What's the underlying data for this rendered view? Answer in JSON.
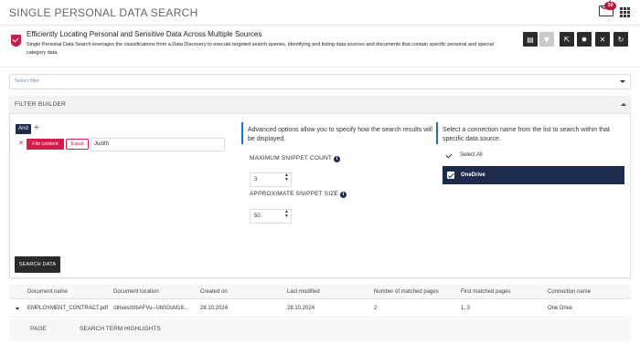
{
  "header": {
    "title": "SINGLE PERSONAL DATA SEARCH",
    "notification_count": "10"
  },
  "info": {
    "title": "Efficiently Locating Personal and Sensitive Data Across Multiple Sources",
    "description": "Single Personal Data Search leverages the classifications from a Data Discovery to execute targeted search queries, identifying and listing data sources and documents that contain specific personal and special category data."
  },
  "toolbar": {
    "buttons": [
      {
        "icon": "save-icon",
        "glyph": "▤"
      },
      {
        "icon": "filter-icon",
        "glyph": "▼",
        "disabled": true
      },
      {
        "icon": "export-icon",
        "glyph": "⇱"
      },
      {
        "icon": "settings-icon",
        "glyph": "✹"
      },
      {
        "icon": "close-icon",
        "glyph": "✕"
      },
      {
        "icon": "refresh-icon",
        "glyph": "↻"
      }
    ]
  },
  "filter_select": {
    "placeholder": "Select filter"
  },
  "filter_builder": {
    "title": "FILTER BUILDER",
    "and_label": "And",
    "plus_label": "+",
    "remove_label": "✕",
    "field_chip": "File content",
    "operator_chip": "Equal",
    "value": "Judith",
    "advanced_text": "Advanced options allow you to specify how the search results will be displayed.",
    "max_snippet_label": "MAXIMUM SNIPPET COUNT",
    "max_snippet_value": "3",
    "approx_snippet_label": "APPROXIMATE SNIPPET SIZE",
    "approx_snippet_value": "50",
    "connection_text": "Select a connection name from the list to search within that specific data source.",
    "select_all_label": "Select All",
    "connections": [
      {
        "name": "OneDrive",
        "checked": true
      }
    ],
    "search_button": "SEARCH DATA"
  },
  "results": {
    "columns": [
      "Document name",
      "Document location",
      "Created on",
      "Last modified",
      "Number of matched pages",
      "First matched pages",
      "Connection name"
    ],
    "rows": [
      [
        "EMPLOYMENT_CONTRACT.pdf",
        "/drives/b!bAFVu--Ub0OsM18...",
        "28.10.2024",
        "28.10.2024",
        "2",
        "1, 3",
        "One Drive"
      ]
    ],
    "sub_columns": [
      "PAGE",
      "SEARCH TERM HIGHLIGHTS"
    ]
  }
}
